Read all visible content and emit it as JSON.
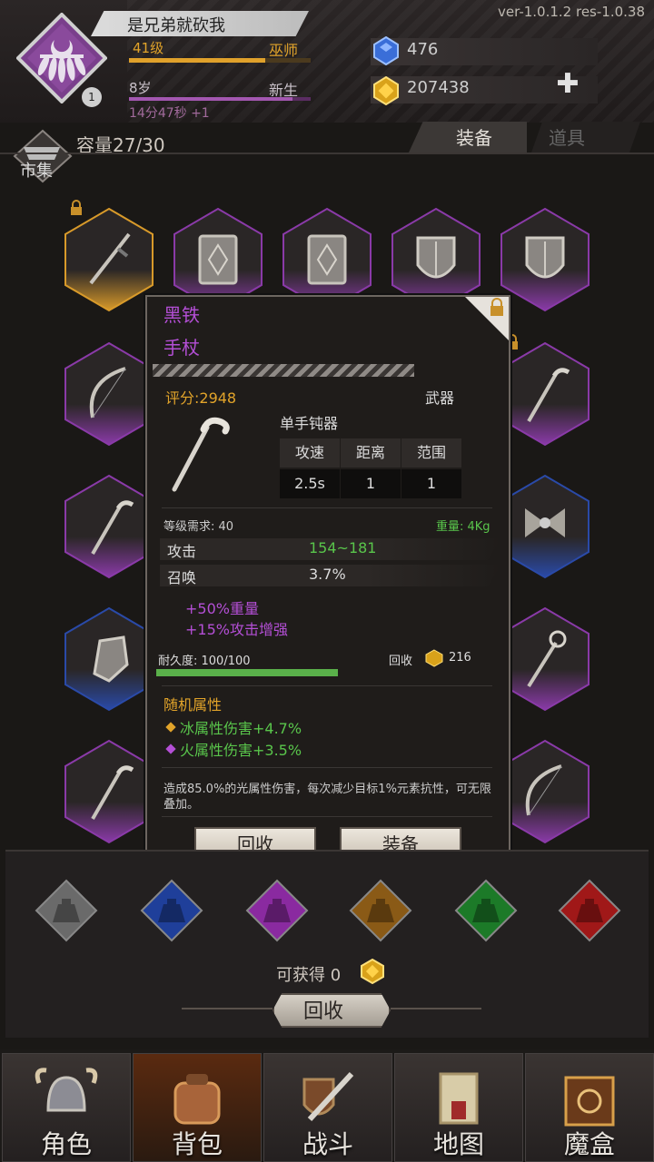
{
  "header": {
    "version": "ver-1.0.1.2  res-1.0.38",
    "player_name": "是兄弟就砍我",
    "level": "41级",
    "class": "巫师",
    "age": "8岁",
    "rank": "新生",
    "timer": "14分47秒 +1",
    "badge": "1",
    "gems": "476",
    "gold": "207438"
  },
  "inventory": {
    "market_label": "市集",
    "capacity": "容量27/30",
    "tabs": [
      "装备",
      "道具"
    ],
    "slots": [
      {
        "item": "sword-icon",
        "rarity": "orange",
        "locked": true
      },
      {
        "item": "book-icon",
        "rarity": "purple"
      },
      {
        "item": "book-icon",
        "rarity": "purple"
      },
      {
        "item": "shield-icon",
        "rarity": "purple"
      },
      {
        "item": "shield-icon",
        "rarity": "purple"
      },
      {
        "item": "bow-icon",
        "rarity": "purple"
      },
      {
        "item": "staff-icon",
        "rarity": "purple",
        "locked": true
      },
      {
        "item": "staff-icon",
        "rarity": "purple"
      },
      {
        "item": "bow-tie-icon",
        "rarity": "blue"
      },
      {
        "item": "gauntlet-icon",
        "rarity": "blue"
      },
      {
        "item": "mace-staff-icon",
        "rarity": "purple"
      },
      {
        "item": "staff-icon",
        "rarity": "purple"
      },
      {
        "item": "bow-icon",
        "rarity": "purple"
      }
    ]
  },
  "popup": {
    "title_line1": "黑铁",
    "title_line2": "手杖",
    "score": "评分:2948",
    "type": "武器",
    "subtype": "单手钝器",
    "stat_headers": [
      "攻速",
      "距离",
      "范围"
    ],
    "stat_values": [
      "2.5s",
      "1",
      "1"
    ],
    "level_req": "等级需求: 40",
    "weight": "重量: 4Kg",
    "attack_label": "攻击",
    "attack_value": "154~181",
    "summon_label": "召唤",
    "summon_value": "3.7%",
    "bonus1": "+50%重量",
    "bonus2": "+15%攻击增强",
    "durability": "耐久度: 100/100",
    "durability_fraction": 1.0,
    "recycle_label": "回收",
    "recycle_value": "216",
    "random_title": "随机属性",
    "random1": "冰属性伤害+4.7%",
    "random2": "火属性伤害+3.5%",
    "description": "造成85.0%的光属性伤害，每次减少目标1%元素抗性，可无限叠加。",
    "btn_recycle": "回收",
    "btn_equip": "装备",
    "colors": {
      "rarity_purple": "#b44fd6",
      "score": "#e2a42a",
      "green": "#59c54b"
    }
  },
  "salvage": {
    "gem_colors": [
      "#6a6a6a",
      "#1f3f9a",
      "#8a2aa0",
      "#8a5a16",
      "#1c7a28",
      "#a01818"
    ],
    "obtain": "可获得 0",
    "recycle_button": "回收"
  },
  "nav": {
    "items": [
      "角色",
      "背包",
      "战斗",
      "地图",
      "魔盒"
    ],
    "active": 1
  }
}
